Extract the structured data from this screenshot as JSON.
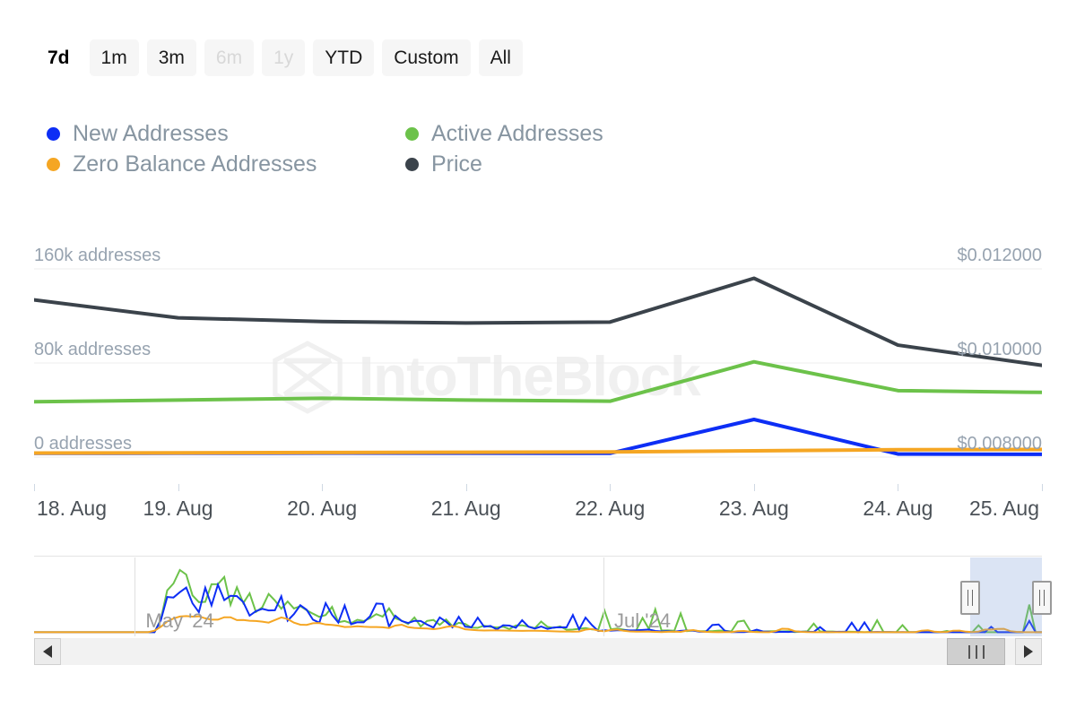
{
  "range_selector": {
    "buttons": [
      {
        "label": "7d",
        "state": "active"
      },
      {
        "label": "1m",
        "state": "normal"
      },
      {
        "label": "3m",
        "state": "normal"
      },
      {
        "label": "6m",
        "state": "disabled"
      },
      {
        "label": "1y",
        "state": "disabled"
      },
      {
        "label": "YTD",
        "state": "normal"
      },
      {
        "label": "Custom",
        "state": "normal"
      },
      {
        "label": "All",
        "state": "normal"
      }
    ]
  },
  "legend": {
    "items": [
      {
        "label": "New Addresses",
        "color": "#0d2ef5"
      },
      {
        "label": "Active Addresses",
        "color": "#6cc24a"
      },
      {
        "label": "Zero Balance Addresses",
        "color": "#f5a623"
      },
      {
        "label": "Price",
        "color": "#3b434b"
      }
    ]
  },
  "watermark": {
    "text": "IntoTheBlock",
    "logo_icon": "intotheblock-logo-icon",
    "color": "#f0f0f0"
  },
  "navigator": {
    "labels": [
      {
        "text": "May '24",
        "x_pct": 10.0
      },
      {
        "text": "Jul '24",
        "x_pct": 56.5
      }
    ],
    "selection": {
      "start_pct": 92.9,
      "end_pct": 100.0
    },
    "handle_icon": "resize-handle-icon"
  },
  "scrollbar": {
    "left_arrow_icon": "arrow-left-icon",
    "right_arrow_icon": "arrow-right-icon",
    "thumb_grip_icon": "grip-icon",
    "thumb_start_pct": 92.9,
    "thumb_end_pct": 99.0
  },
  "chart_data": {
    "type": "line",
    "title": "",
    "xlabel": "",
    "ylabel": "addresses",
    "y2label": "price",
    "grid": true,
    "legend_position": "top-left",
    "x": [
      "18. Aug",
      "19. Aug",
      "20. Aug",
      "21. Aug",
      "22. Aug",
      "23. Aug",
      "24. Aug",
      "25. Aug"
    ],
    "left_axis": {
      "ticks": [
        {
          "value": 0,
          "label": "0 addresses"
        },
        {
          "value": 80000,
          "label": "80k addresses"
        },
        {
          "value": 160000,
          "label": "160k addresses"
        }
      ],
      "ylim": [
        0,
        160000
      ],
      "unit": "addresses"
    },
    "right_axis": {
      "ticks": [
        {
          "value": 0.008,
          "label": "$0.008000"
        },
        {
          "value": 0.01,
          "label": "$0.010000"
        },
        {
          "value": 0.012,
          "label": "$0.012000"
        }
      ],
      "ylim": [
        0.008,
        0.012
      ],
      "unit": "USD"
    },
    "series": [
      {
        "name": "New Addresses",
        "color": "#0d2ef5",
        "axis": "left",
        "values": [
          3200,
          3300,
          3400,
          3300,
          3200,
          32000,
          2600,
          2400
        ]
      },
      {
        "name": "Active Addresses",
        "color": "#6cc24a",
        "axis": "left",
        "values": [
          47000,
          48500,
          50000,
          48500,
          47500,
          81000,
          56500,
          55000
        ]
      },
      {
        "name": "Zero Balance Addresses",
        "color": "#f5a623",
        "axis": "left",
        "values": [
          3400,
          3600,
          3900,
          4100,
          4400,
          5300,
          6300,
          6500
        ]
      },
      {
        "name": "Price",
        "color": "#3b434b",
        "axis": "right",
        "values": [
          0.01134,
          0.01096,
          0.01088,
          0.01085,
          0.01087,
          0.0118,
          0.01038,
          0.00995
        ]
      }
    ]
  }
}
